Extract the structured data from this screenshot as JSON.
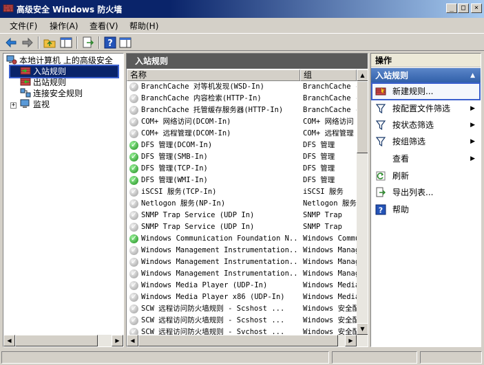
{
  "window": {
    "title": "高级安全 Windows 防火墙",
    "min": "_",
    "max": "□",
    "close": "×"
  },
  "menu": [
    "文件(F)",
    "操作(A)",
    "查看(V)",
    "帮助(H)"
  ],
  "tree": {
    "root": "本地计算机 上的高级安全",
    "items": [
      "入站规则",
      "出站规则",
      "连接安全规则",
      "监视"
    ],
    "expander": "+"
  },
  "center": {
    "title": "入站规则",
    "columns": {
      "name": "名称",
      "group": "组"
    },
    "rules": [
      {
        "name": "BranchCache 对等机发现(WSD-In)",
        "group": "BranchCache -",
        "enabled": false
      },
      {
        "name": "BranchCache 内容检索(HTTP-In)",
        "group": "BranchCache -",
        "enabled": false
      },
      {
        "name": "BranchCache 托管缓存服务器(HTTP-In)",
        "group": "BranchCache -",
        "enabled": false
      },
      {
        "name": "COM+ 网络访问(DCOM-In)",
        "group": "COM+ 网络访问",
        "enabled": false
      },
      {
        "name": "COM+ 远程管理(DCOM-In)",
        "group": "COM+ 远程管理",
        "enabled": false
      },
      {
        "name": "DFS 管理(DCOM-In)",
        "group": "DFS 管理",
        "enabled": true
      },
      {
        "name": "DFS 管理(SMB-In)",
        "group": "DFS 管理",
        "enabled": true
      },
      {
        "name": "DFS 管理(TCP-In)",
        "group": "DFS 管理",
        "enabled": true
      },
      {
        "name": "DFS 管理(WMI-In)",
        "group": "DFS 管理",
        "enabled": true
      },
      {
        "name": "iSCSI 服务(TCP-In)",
        "group": "iSCSI 服务",
        "enabled": false
      },
      {
        "name": "Netlogon 服务(NP-In)",
        "group": "Netlogon 服务",
        "enabled": false
      },
      {
        "name": "SNMP Trap Service (UDP In)",
        "group": "SNMP Trap",
        "enabled": false
      },
      {
        "name": "SNMP Trap Service (UDP In)",
        "group": "SNMP Trap",
        "enabled": false
      },
      {
        "name": "Windows Communication Foundation N...",
        "group": "Windows Commu",
        "enabled": true
      },
      {
        "name": "Windows Management Instrumentation...",
        "group": "Windows Manag",
        "enabled": false
      },
      {
        "name": "Windows Management Instrumentation...",
        "group": "Windows Manag",
        "enabled": false
      },
      {
        "name": "Windows Management Instrumentation...",
        "group": "Windows Manag",
        "enabled": false
      },
      {
        "name": "Windows Media Player (UDP-In)",
        "group": "Windows Media",
        "enabled": false
      },
      {
        "name": "Windows Media Player x86 (UDP-In)",
        "group": "Windows Media",
        "enabled": false
      },
      {
        "name": "SCW 远程访问防火墙规则 - Scshost ...",
        "group": "Windows 安全配",
        "enabled": false
      },
      {
        "name": "SCW 远程访问防火墙规则 - Scshost ...",
        "group": "Windows 安全配",
        "enabled": false
      },
      {
        "name": "SCW 远程访问防火墙规则 - Svchost ...",
        "group": "Windows 安全配",
        "enabled": false
      }
    ]
  },
  "actions": {
    "title": "操作",
    "section": "入站规则",
    "collapse": "▲",
    "items": [
      {
        "label": "新建规则...",
        "icon": "new-rule-icon",
        "submenu": false
      },
      {
        "label": "按配置文件筛选",
        "icon": "filter-icon",
        "submenu": true
      },
      {
        "label": "按状态筛选",
        "icon": "filter-icon",
        "submenu": true
      },
      {
        "label": "按组筛选",
        "icon": "filter-icon",
        "submenu": true
      },
      {
        "label": "查看",
        "icon": "",
        "submenu": true
      },
      {
        "label": "刷新",
        "icon": "refresh-icon",
        "submenu": false
      },
      {
        "label": "导出列表...",
        "icon": "export-icon",
        "submenu": false
      },
      {
        "label": "帮助",
        "icon": "help-icon",
        "submenu": false
      }
    ],
    "submenu_arrow": "▶"
  },
  "scroll": {
    "up": "▲",
    "down": "▼",
    "left": "◀",
    "right": "▶"
  }
}
